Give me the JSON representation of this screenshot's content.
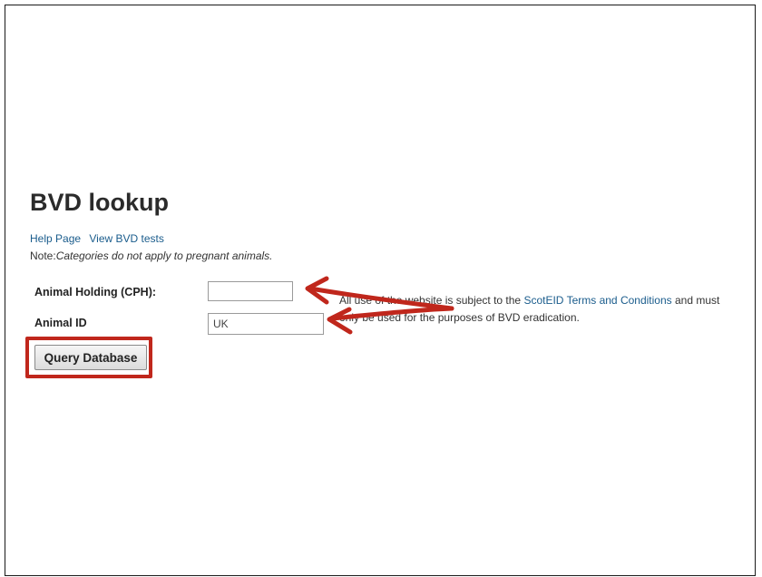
{
  "page": {
    "title": "BVD lookup",
    "links": [
      "Help Page",
      "View BVD tests"
    ],
    "note_prefix": "Note:",
    "note_text": "Categories do not apply to pregnant animals."
  },
  "form": {
    "holding_label": "Animal Holding (CPH):",
    "holding_value": "",
    "animal_id_label": "Animal ID",
    "animal_id_value": "UK",
    "submit_label": "Query Database"
  },
  "disclaimer": {
    "line1_before": "All use of the website is subject to the",
    "terms_link": "ScotEID Terms and Conditions",
    "line1_after": " and must",
    "line2": "only be used for the purposes of BVD eradication."
  },
  "colors": {
    "annotation": "#c0271c",
    "link": "#1a5c8c"
  }
}
